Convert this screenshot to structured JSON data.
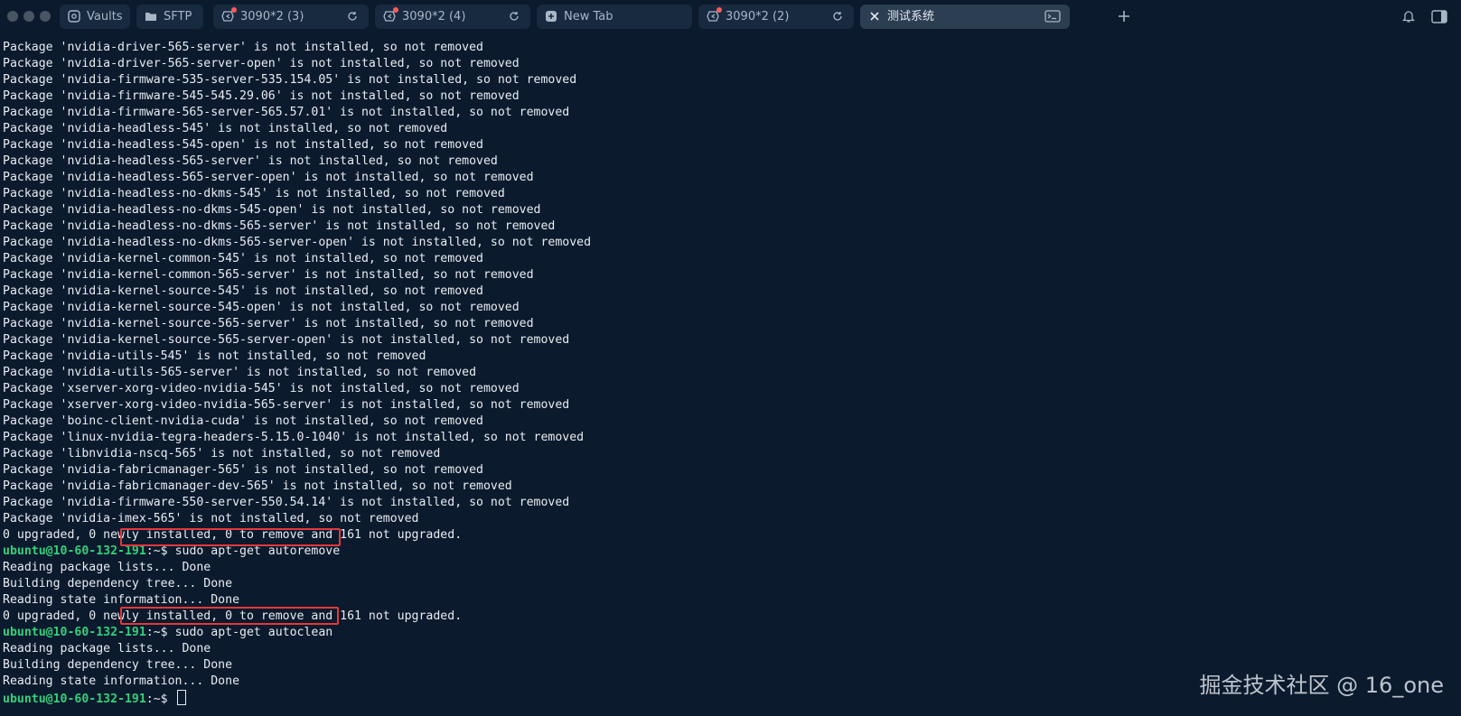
{
  "colors": {
    "background": "#0b1a2d",
    "prompt_user": "#33d17a",
    "highlight": "#e5383b",
    "notification_dot": "#ff5b5b"
  },
  "tabs": [
    {
      "label": "Vaults",
      "icon": "vault-icon"
    },
    {
      "label": "SFTP",
      "icon": "folder-icon"
    },
    {
      "label": "3090*2 (3)",
      "icon": "ubuntu-icon",
      "notification": true
    },
    {
      "label": "3090*2 (4)",
      "icon": "ubuntu-icon",
      "notification": true
    },
    {
      "label": "New Tab",
      "icon": "plus-square-icon"
    },
    {
      "label": "3090*2 (2)",
      "icon": "ubuntu-icon",
      "notification": true
    },
    {
      "label": "测试系统",
      "icon": "close-icon",
      "active": true
    }
  ],
  "terminal": {
    "lines": [
      "Package 'nvidia-driver-565-server' is not installed, so not removed",
      "Package 'nvidia-driver-565-server-open' is not installed, so not removed",
      "Package 'nvidia-firmware-535-server-535.154.05' is not installed, so not removed",
      "Package 'nvidia-firmware-545-545.29.06' is not installed, so not removed",
      "Package 'nvidia-firmware-565-server-565.57.01' is not installed, so not removed",
      "Package 'nvidia-headless-545' is not installed, so not removed",
      "Package 'nvidia-headless-545-open' is not installed, so not removed",
      "Package 'nvidia-headless-565-server' is not installed, so not removed",
      "Package 'nvidia-headless-565-server-open' is not installed, so not removed",
      "Package 'nvidia-headless-no-dkms-545' is not installed, so not removed",
      "Package 'nvidia-headless-no-dkms-545-open' is not installed, so not removed",
      "Package 'nvidia-headless-no-dkms-565-server' is not installed, so not removed",
      "Package 'nvidia-headless-no-dkms-565-server-open' is not installed, so not removed",
      "Package 'nvidia-kernel-common-545' is not installed, so not removed",
      "Package 'nvidia-kernel-common-565-server' is not installed, so not removed",
      "Package 'nvidia-kernel-source-545' is not installed, so not removed",
      "Package 'nvidia-kernel-source-545-open' is not installed, so not removed",
      "Package 'nvidia-kernel-source-565-server' is not installed, so not removed",
      "Package 'nvidia-kernel-source-565-server-open' is not installed, so not removed",
      "Package 'nvidia-utils-545' is not installed, so not removed",
      "Package 'nvidia-utils-565-server' is not installed, so not removed",
      "Package 'xserver-xorg-video-nvidia-545' is not installed, so not removed",
      "Package 'xserver-xorg-video-nvidia-565-server' is not installed, so not removed",
      "Package 'boinc-client-nvidia-cuda' is not installed, so not removed",
      "Package 'linux-nvidia-tegra-headers-5.15.0-1040' is not installed, so not removed",
      "Package 'libnvidia-nscq-565' is not installed, so not removed",
      "Package 'nvidia-fabricmanager-565' is not installed, so not removed",
      "Package 'nvidia-fabricmanager-dev-565' is not installed, so not removed",
      "Package 'nvidia-firmware-550-server-550.54.14' is not installed, so not removed",
      "Package 'nvidia-imex-565' is not installed, so not removed",
      "0 upgraded, 0 newly installed, 0 to remove and 161 not upgraded.",
      {
        "prompt": "ubuntu@10-60-132-191",
        "suffix": ":~$ ",
        "command": "sudo apt-get autoremove"
      },
      "Reading package lists... Done",
      "Building dependency tree... Done",
      "Reading state information... Done",
      "0 upgraded, 0 newly installed, 0 to remove and 161 not upgraded.",
      {
        "prompt": "ubuntu@10-60-132-191",
        "suffix": ":~$ ",
        "command": "sudo apt-get autoclean"
      },
      "Reading package lists... Done",
      "Building dependency tree... Done",
      "Reading state information... Done",
      {
        "prompt": "ubuntu@10-60-132-191",
        "suffix": ":~$ ",
        "command": "",
        "cursor": true
      }
    ]
  },
  "watermark": "掘金技术社区 @ 16_one"
}
